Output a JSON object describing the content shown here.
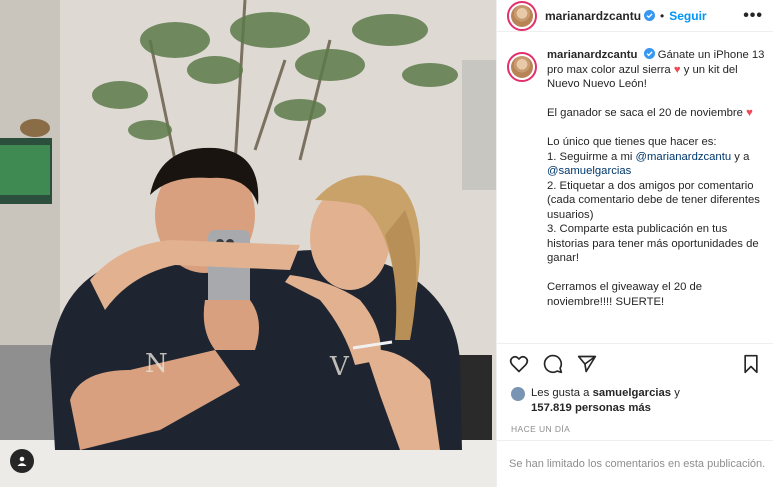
{
  "post": {
    "username": "marianardzcantu",
    "follow_label": "Seguir",
    "more_label": "•••",
    "caption_lines": {
      "p1_text": "Gánate un iPhone 13 pro max color azul sierra",
      "p1_heart": "♥",
      "p1_rest": "y un kit del Nuevo Nuevo León!",
      "p2_text": "El ganador se saca el 20 de noviembre",
      "p2_heart": "♥",
      "p3_intro": "Lo único que tienes que hacer es:",
      "p3_step1_pre": "1. Seguirme a mi",
      "p3_mention1": "@marianardzcantu",
      "p3_step1_mid": "y a",
      "p3_mention2": "@samuelgarcias",
      "p3_step2": "2. Etiquetar a dos amigos por comentario (cada comentario debe de tener diferentes usuarios)",
      "p3_step3": "3. Comparte esta publicación en tus historias para tener más oportunidades de ganar!",
      "p4_text": "Cerramos el giveaway el 20 de noviembre!!!! SUERTE!"
    },
    "likes": {
      "prefix": "Les gusta a",
      "user": "samuelgarcias",
      "connector": "y",
      "count": "157.819 personas más"
    },
    "timestamp": "HACE UN DÍA",
    "comments_disabled": "Se han limitado los comentarios en esta publicación."
  },
  "colors": {
    "follow": "#0095f6",
    "mention": "#00376b",
    "heart": "#ed4956",
    "muted": "#8e8e8e"
  },
  "icons": {
    "verified": "verified-badge-icon",
    "like": "heart-outline-icon",
    "comment": "comment-bubble-icon",
    "share": "paper-plane-icon",
    "save": "bookmark-icon",
    "user_tag": "user-tag-icon"
  }
}
